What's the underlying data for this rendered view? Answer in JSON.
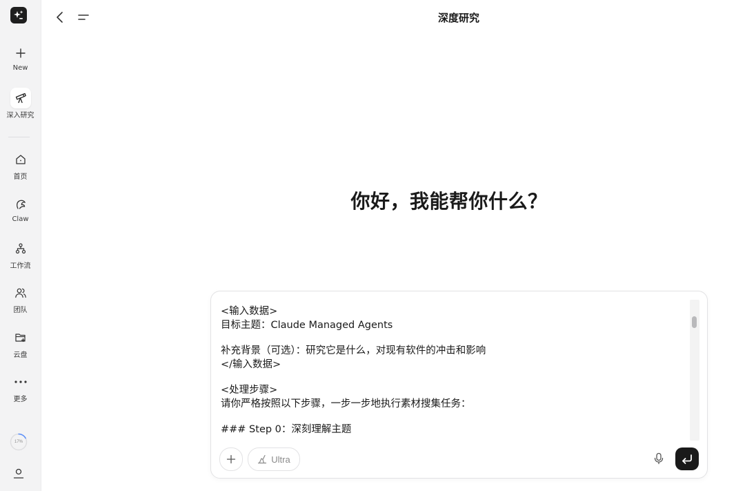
{
  "sidebar": {
    "logo_icon": "sparkle-logo-icon",
    "items": [
      {
        "label": "New",
        "icon": "plus-icon"
      },
      {
        "label": "深入研究",
        "icon": "telescope-icon",
        "active": true
      },
      {
        "label": "首页",
        "icon": "home-icon"
      },
      {
        "label": "Claw",
        "icon": "claw-icon"
      },
      {
        "label": "工作流",
        "icon": "workflow-icon"
      },
      {
        "label": "团队",
        "icon": "team-icon"
      },
      {
        "label": "云盘",
        "icon": "cloud-drive-icon"
      },
      {
        "label": "更多",
        "icon": "more-icon"
      }
    ],
    "usage": {
      "label": "17%",
      "value": 17
    },
    "user_icon": "user-icon"
  },
  "header": {
    "title": "深度研究"
  },
  "main": {
    "greeting": "你好，我能帮你什么？"
  },
  "composer": {
    "lines": [
      "<输入数据>",
      "目标主题：Claude Managed Agents",
      "",
      "补充背景（可选）：研究它是什么，对现有软件的冲击和影响",
      "</输入数据>",
      "",
      "<处理步骤>",
      "请你严格按照以下步骤，一步一步地执行素材搜集任务：",
      "",
      "### Step 0：深刻理解主题"
    ],
    "mode_label": "Ultra",
    "colors": {
      "send_button": "#1a1a1a",
      "border": "#e2e2e4"
    }
  }
}
